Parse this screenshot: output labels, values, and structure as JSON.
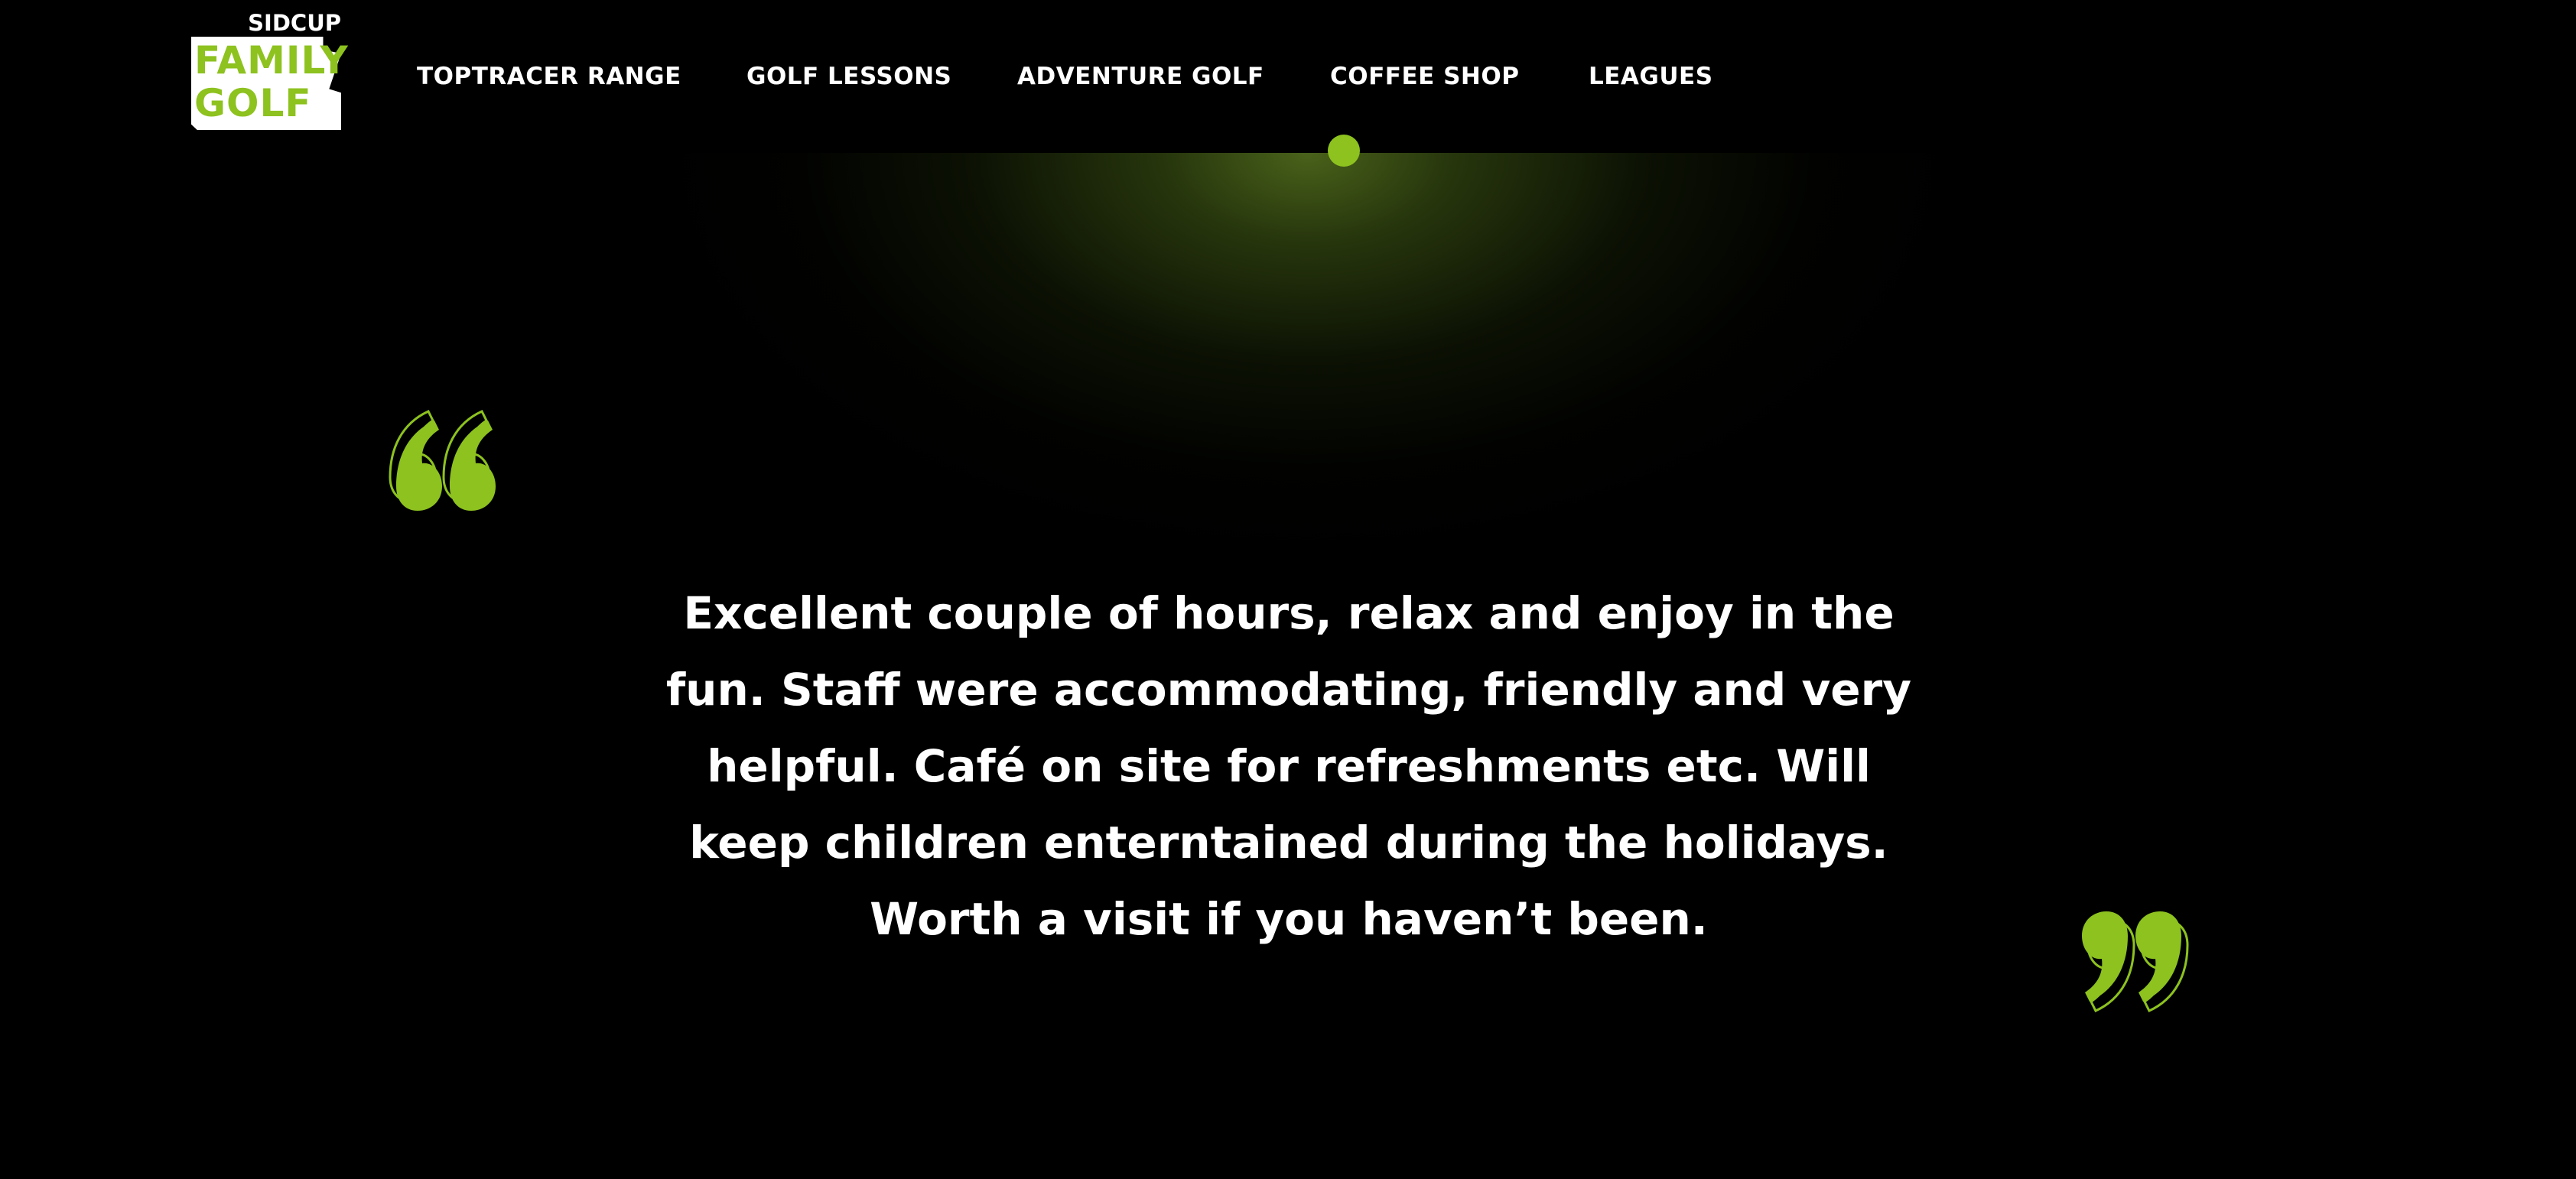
{
  "logo": {
    "top_text": "SIDCUP",
    "line1": "FAMILY",
    "line2": "GOLF"
  },
  "nav": {
    "items": [
      {
        "label": "TOPTRACER RANGE"
      },
      {
        "label": "GOLF LESSONS"
      },
      {
        "label": "ADVENTURE GOLF"
      },
      {
        "label": "COFFEE SHOP",
        "active": true
      },
      {
        "label": "LEAGUES"
      }
    ]
  },
  "testimonial": {
    "lines": [
      "Excellent couple of hours, relax and enjoy in the",
      "fun. Staff were accommodating, friendly and very",
      "helpful. Café on site for refreshments etc. Will",
      "keep children enterntained during the holidays.",
      "Worth a visit if you haven’t been."
    ]
  },
  "icons": {
    "open_quote": "open-quote-icon",
    "close_quote": "close-quote-icon",
    "active_indicator": "dot"
  },
  "colors": {
    "background": "#000000",
    "accent": "#8dc21f",
    "text": "#ffffff"
  }
}
